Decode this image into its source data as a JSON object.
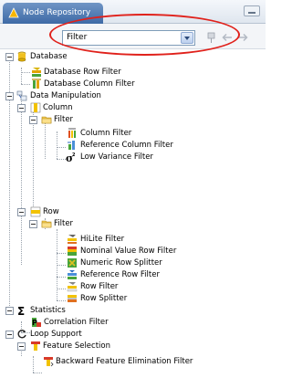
{
  "window": {
    "tab_title": "Node Repository",
    "tab_icon": "knime-icon"
  },
  "toolbar": {
    "filter_value": "Filter",
    "icons": [
      "pin-icon",
      "back-arrow-icon",
      "forward-arrow-icon"
    ]
  },
  "tree": [
    {
      "id": "database",
      "label": "Database",
      "icon": "database-icon",
      "expanded": true
    },
    {
      "id": "database-row-filter",
      "label": "Database Row Filter",
      "icon": "db-row-filter-icon"
    },
    {
      "id": "database-column-filter",
      "label": "Database Column Filter",
      "icon": "db-column-filter-icon"
    },
    {
      "id": "data-manipulation",
      "label": "Data Manipulation",
      "icon": "data-manipulation-icon",
      "expanded": true
    },
    {
      "id": "column",
      "label": "Column",
      "icon": "column-icon",
      "expanded": true
    },
    {
      "id": "column-filter-folder",
      "label": "Filter",
      "icon": "folder-icon",
      "expanded": true
    },
    {
      "id": "column-filter",
      "label": "Column Filter",
      "icon": "column-filter-icon"
    },
    {
      "id": "reference-column-filter",
      "label": "Reference Column Filter",
      "icon": "reference-column-filter-icon"
    },
    {
      "id": "low-variance-filter",
      "label": "Low Variance Filter",
      "icon": "sigma-squared-icon"
    },
    {
      "id": "row",
      "label": "Row",
      "icon": "row-icon",
      "expanded": true
    },
    {
      "id": "row-filter-folder",
      "label": "Filter",
      "icon": "folder-icon",
      "expanded": true
    },
    {
      "id": "hilite-filter",
      "label": "HiLite Filter",
      "icon": "hilite-filter-icon"
    },
    {
      "id": "nominal-value-row-filter",
      "label": "Nominal Value Row Filter",
      "icon": "nominal-filter-icon"
    },
    {
      "id": "numeric-row-splitter",
      "label": "Numeric Row Splitter",
      "icon": "numeric-splitter-icon"
    },
    {
      "id": "reference-row-filter",
      "label": "Reference Row Filter",
      "icon": "reference-row-filter-icon"
    },
    {
      "id": "row-filter",
      "label": "Row Filter",
      "icon": "row-filter-icon"
    },
    {
      "id": "row-splitter",
      "label": "Row Splitter",
      "icon": "row-splitter-icon"
    },
    {
      "id": "statistics",
      "label": "Statistics",
      "icon": "sigma-icon",
      "expanded": true
    },
    {
      "id": "correlation-filter",
      "label": "Correlation Filter",
      "icon": "correlation-filter-icon"
    },
    {
      "id": "loop-support",
      "label": "Loop Support",
      "icon": "loop-icon",
      "expanded": true
    },
    {
      "id": "feature-selection",
      "label": "Feature Selection",
      "icon": "feature-selection-icon",
      "expanded": true
    },
    {
      "id": "backward-feature-elimination-filter",
      "label": "Backward Feature Elimination Filter",
      "icon": "feature-elimination-icon"
    }
  ],
  "colors": {
    "tab_blue": "#3e6aa6",
    "highlight_red": "#e0211b",
    "folder_yellow": "#f2c94c"
  }
}
